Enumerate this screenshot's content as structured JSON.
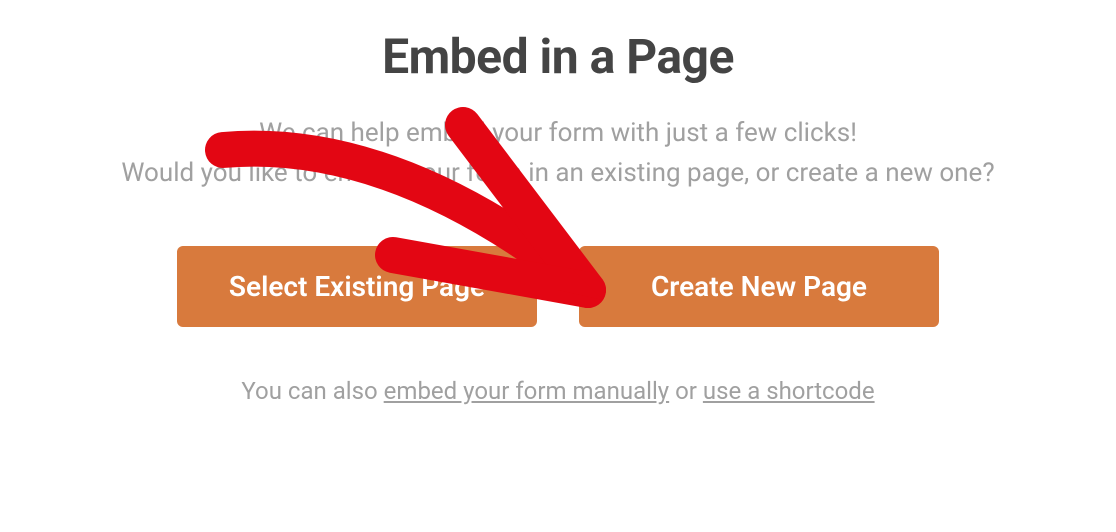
{
  "title": "Embed in a Page",
  "subtitle_line1": "We can help embed your form with just a few clicks!",
  "subtitle_line2": "Would you like to embed your form in an existing page, or create a new one?",
  "buttons": {
    "select_existing": "Select Existing Page",
    "create_new": "Create New Page"
  },
  "footer": {
    "prefix": "You can also ",
    "link1": "embed your form manually",
    "middle": " or ",
    "link2": "use a shortcode"
  }
}
